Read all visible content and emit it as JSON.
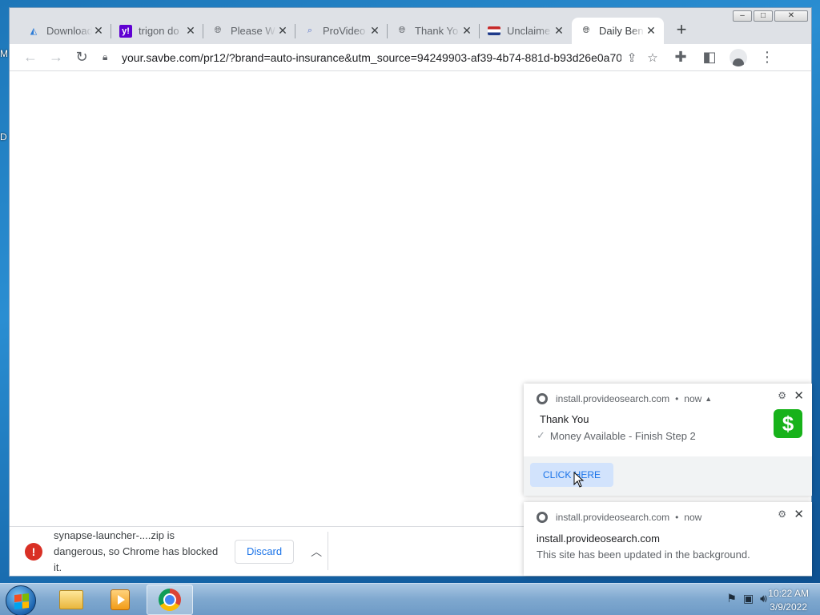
{
  "desktop": {
    "edge_letters": [
      "M",
      "D"
    ]
  },
  "window": {
    "controls": {
      "minimize": "–",
      "restore": "□",
      "close": "✕"
    }
  },
  "tabs": [
    {
      "title": "Download",
      "favicon": "mega-icon",
      "favicon_color": "#2c7bd6"
    },
    {
      "title": "trigon do",
      "favicon": "yahoo-icon",
      "favicon_color": "#6001d2"
    },
    {
      "title": "Please W",
      "favicon": "globe-icon",
      "favicon_color": "#5f6368"
    },
    {
      "title": "ProVideo",
      "favicon": "provideo-icon",
      "favicon_color": "#5470c8"
    },
    {
      "title": "Thank Yo",
      "favicon": "globe-icon",
      "favicon_color": "#5f6368"
    },
    {
      "title": "Unclaime",
      "favicon": "flag-icon",
      "favicon_color": "#c62828"
    },
    {
      "title": "Daily Ben",
      "favicon": "globe-icon",
      "favicon_color": "#5f6368",
      "active": true
    }
  ],
  "toolbar": {
    "url": "your.savbe.com/pr12/?brand=auto-insurance&utm_source=94249903-af39-4b74-881d-b93d26e0a70e..."
  },
  "download": {
    "message": "synapse-launcher-....zip is dangerous, so Chrome has blocked it.",
    "discard_label": "Discard"
  },
  "notifications": [
    {
      "origin": "install.provideosearch.com",
      "time": "now",
      "title": "Thank You",
      "message": "Money Available - Finish Step 2",
      "button": "CLICK HERE",
      "logo": "$",
      "logo_color": "#17b21a"
    },
    {
      "origin": "install.provideosearch.com",
      "time": "now",
      "title": "install.provideosearch.com",
      "message": "This site has been updated in the background."
    }
  ],
  "taskbar": {
    "apps": [
      "explorer-icon",
      "media-player-icon",
      "chrome-icon"
    ],
    "time": "10:22 AM",
    "date": "3/9/2022"
  }
}
